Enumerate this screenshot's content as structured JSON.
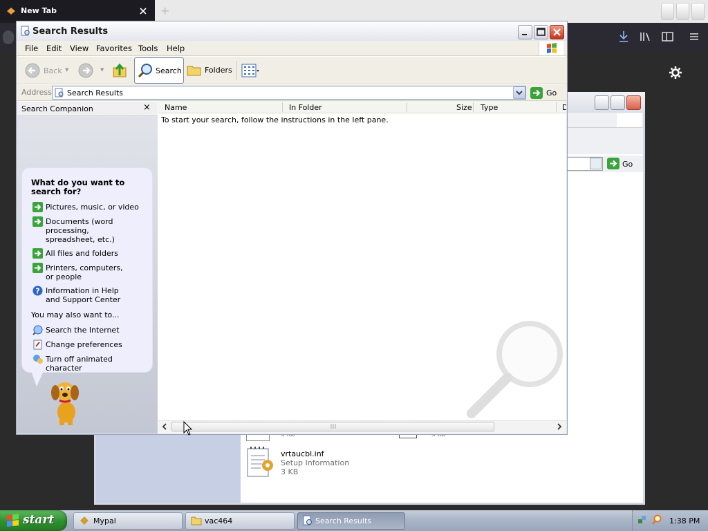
{
  "browser": {
    "tab_title": "New Tab",
    "new_tab_symbol": "+"
  },
  "behind_window": {
    "go_label": "Go",
    "file": {
      "name": "vrtaucbl.inf",
      "type": "Setup Information",
      "size": "3 KB"
    },
    "partial_text_1": "3 KB",
    "partial_text_2": "3 KB"
  },
  "window": {
    "title": "Search Results",
    "menu": [
      "File",
      "Edit",
      "View",
      "Favorites",
      "Tools",
      "Help"
    ],
    "toolbar": {
      "back": "Back",
      "search": "Search",
      "folders": "Folders"
    },
    "address": {
      "label": "Address",
      "value": "Search Results",
      "go": "Go"
    },
    "search_pane": {
      "title": "Search Companion",
      "close": "×",
      "question": "What do you want to search for?",
      "options": [
        "Pictures, music, or video",
        "Documents (word processing, spreadsheet, etc.)",
        "All files and folders",
        "Printers, computers, or people",
        "Information in Help and Support Center"
      ],
      "also_label": "You may also want to...",
      "also_options": [
        "Search the Internet",
        "Change preferences",
        "Turn off animated character"
      ]
    },
    "list": {
      "columns": [
        "Name",
        "In Folder",
        "Size",
        "Type",
        "D"
      ],
      "empty_message": "To start your search, follow the instructions in the left pane."
    }
  },
  "taskbar": {
    "start": "start",
    "tasks": [
      "Mypal",
      "vac464",
      "Search Results"
    ],
    "active_task": "Search Results",
    "clock": "1:38 PM"
  },
  "colors": {
    "taskbar": "#aab5c7",
    "start": "#2f8f2f",
    "pane": "#c2c7d3",
    "close_button": "#c6331b"
  },
  "icons": [
    "search-icon",
    "folder-icon",
    "back-arrow-icon",
    "forward-arrow-icon",
    "up-folder-icon",
    "views-icon",
    "go-arrow-icon",
    "help-icon",
    "globe-search-icon",
    "preferences-icon",
    "dog-character-icon"
  ]
}
